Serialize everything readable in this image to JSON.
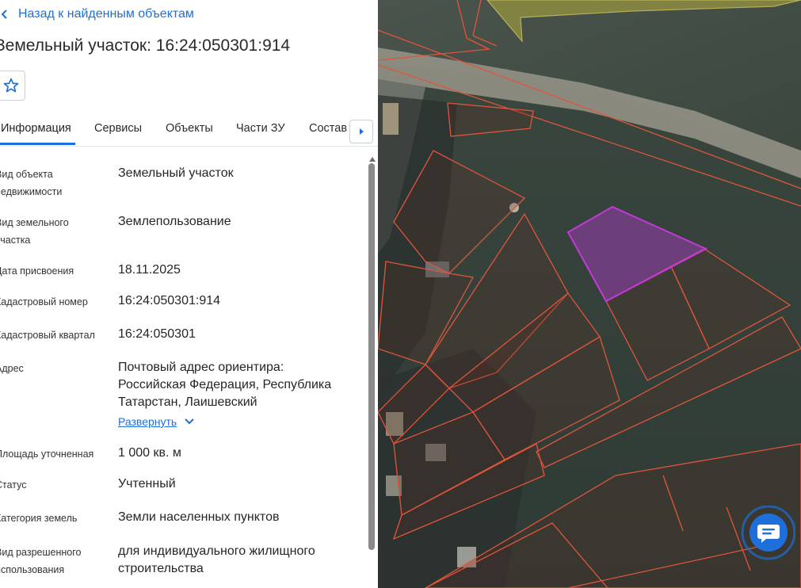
{
  "nav": {
    "back_label": "Назад к найденным объектам"
  },
  "header": {
    "title": "Земельный участок: 16:24:050301:914"
  },
  "tabs": [
    {
      "label": "Информация",
      "active": true
    },
    {
      "label": "Сервисы"
    },
    {
      "label": "Объекты"
    },
    {
      "label": "Части ЗУ"
    },
    {
      "label": "Состав"
    }
  ],
  "info": [
    {
      "label": "Вид объекта недвижимости",
      "value": "Земельный участок"
    },
    {
      "label": "Вид земельного участка",
      "value": "Землепользование"
    },
    {
      "label": "Дата присвоения",
      "value": "18.11.2025"
    },
    {
      "label": "Кадастровый номер",
      "value": "16:24:050301:914"
    },
    {
      "label": "Кадастровый квартал",
      "value": "16:24:050301"
    },
    {
      "label": "Адрес",
      "value": "Почтовый адрес ориентира: Российская Федерация, Республика Татарстан, Лаишевский"
    },
    {
      "label": "Площадь уточненная",
      "value": "1 000 кв. м"
    },
    {
      "label": "Статус",
      "value": "Учтенный"
    },
    {
      "label": "Категория земель",
      "value": "Земли населенных пунктов"
    },
    {
      "label": "Вид разрешенного использования",
      "value": "для индивидуального жилищного строительства"
    }
  ],
  "address_expand_label": "Развернуть",
  "colors": {
    "accent": "#1e6fd9",
    "parcel_border": "#e0553a",
    "selected_parcel": "#b03ac8",
    "chat_button": "#1e6fd9"
  },
  "icons": [
    "chevron-left-icon",
    "star-icon",
    "chevron-right-icon",
    "chevron-down-icon",
    "chat-icon"
  ]
}
